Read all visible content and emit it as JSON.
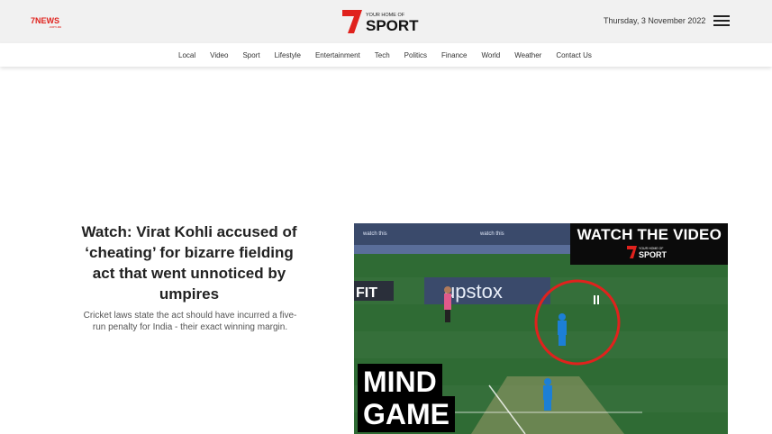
{
  "header": {
    "left_logo": "7NEWS",
    "left_logo_sub": ".com.au",
    "brand_tagline": "YOUR HOME OF",
    "brand_name": "SPORT",
    "date": "Thursday, 3 November 2022",
    "menu_icon": "hamburger-menu-icon"
  },
  "nav": {
    "items": [
      "Local",
      "Video",
      "Sport",
      "Lifestyle",
      "Entertainment",
      "Tech",
      "Politics",
      "Finance",
      "World",
      "Weather",
      "Contact Us"
    ]
  },
  "article": {
    "headline": "Watch: Virat Kohli accused of ‘cheating’ for bizarre fielding act that went unnoticed by umpires",
    "summary": "Cricket laws state the act should have incurred a five-run penalty for India - their exact winning margin."
  },
  "video": {
    "overlay_title": "WATCH THE VIDEO",
    "overlay_tagline": "YOUR HOME OF",
    "overlay_brand": "SPORT",
    "caption_line1": "MIND",
    "caption_line2": "GAME",
    "board_text": "upstox",
    "board_left": "FIT",
    "colors": {
      "pitch": "#2f6b34",
      "circle": "#e0221d",
      "india_blue": "#1c7fd6"
    }
  },
  "colors": {
    "topbar": "#f1f1f1",
    "accent_red": "#e0221d"
  }
}
